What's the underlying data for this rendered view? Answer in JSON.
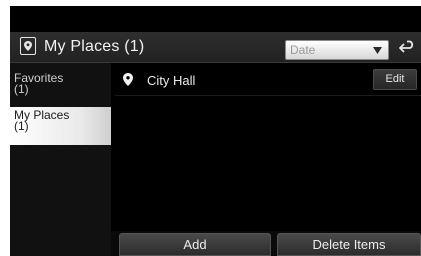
{
  "header": {
    "title": "My Places (1)",
    "sort": {
      "selected": "Date"
    }
  },
  "sidebar": {
    "items": [
      {
        "label": "Favorites",
        "count": "(1)",
        "selected": false
      },
      {
        "label": "My Places",
        "count": "(1)",
        "selected": true
      }
    ]
  },
  "list": {
    "items": [
      {
        "name": "City Hall",
        "edit_label": "Edit"
      }
    ]
  },
  "footer": {
    "add_label": "Add",
    "delete_label": "Delete Items"
  }
}
